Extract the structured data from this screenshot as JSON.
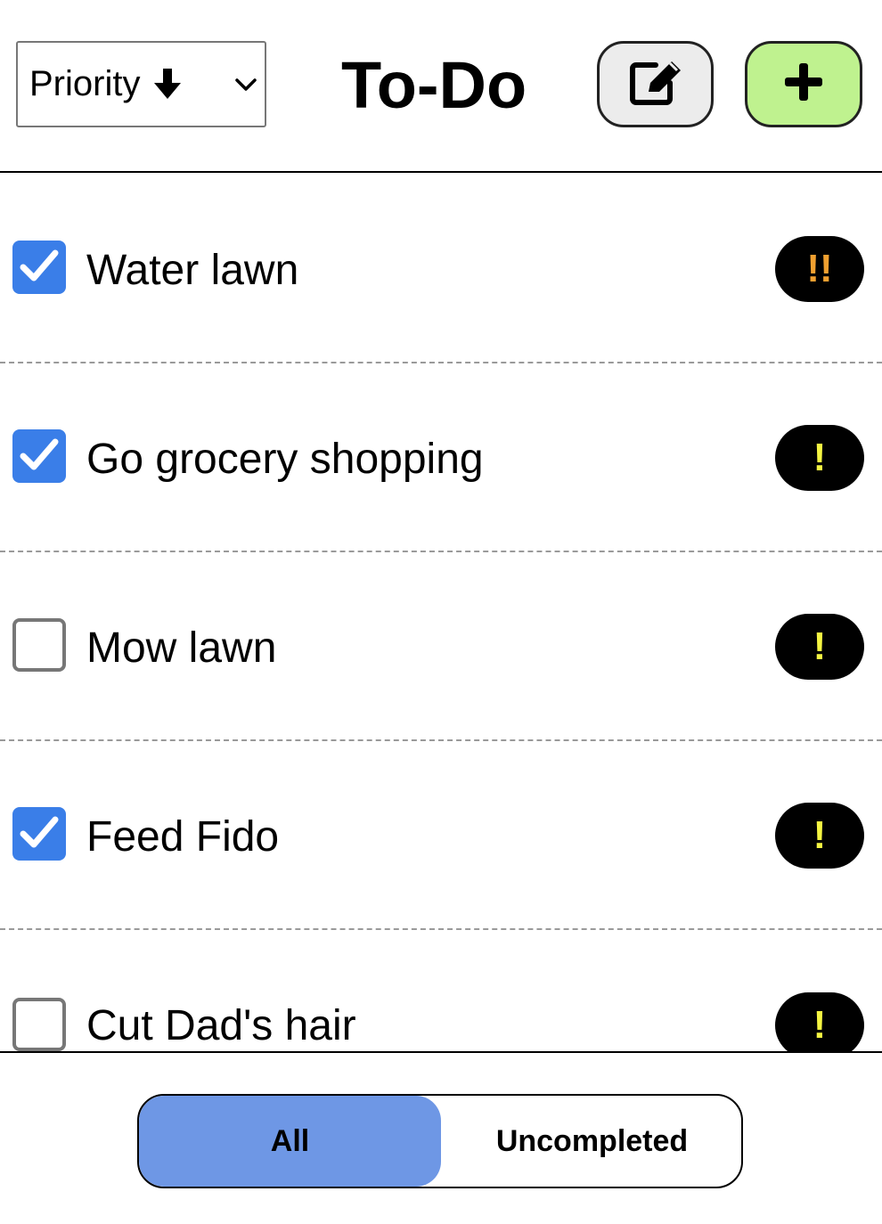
{
  "header": {
    "sort_label": "Priority",
    "title": "To-Do",
    "edit_icon": "edit-icon",
    "add_icon": "plus-icon"
  },
  "tasks": [
    {
      "label": "Water lawn",
      "checked": true,
      "priority": "!!",
      "priority_color": "#f0a030"
    },
    {
      "label": "Go grocery shopping",
      "checked": true,
      "priority": "!",
      "priority_color": "#f5f542"
    },
    {
      "label": "Mow lawn",
      "checked": false,
      "priority": "!",
      "priority_color": "#f5f542"
    },
    {
      "label": "Feed Fido",
      "checked": true,
      "priority": "!",
      "priority_color": "#f5f542"
    },
    {
      "label": "Cut Dad's hair",
      "checked": false,
      "priority": "!",
      "priority_color": "#f5f542"
    }
  ],
  "filter": {
    "all_label": "All",
    "uncompleted_label": "Uncompleted",
    "selected": "All"
  },
  "colors": {
    "accent": "#3a7ee8",
    "segment_selected": "#6e97e5",
    "add_button": "#bff28f"
  }
}
